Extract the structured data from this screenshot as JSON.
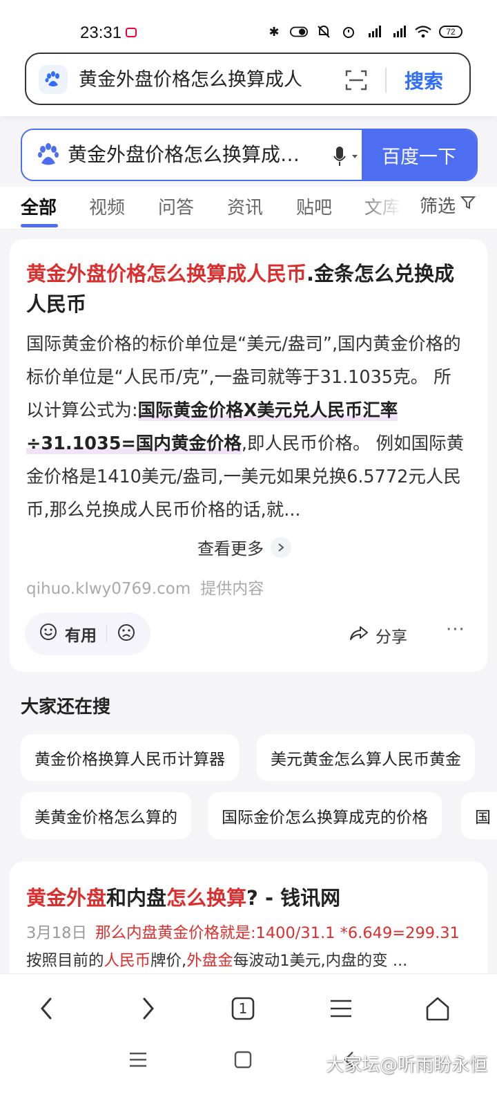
{
  "status": {
    "time": "23:31",
    "battery": "72"
  },
  "address_bar": {
    "query": "黄金外盘价格怎么换算成人",
    "search_label": "搜索"
  },
  "search_box": {
    "query": "黄金外盘价格怎么换算成人民币",
    "button_label": "百度一下"
  },
  "tabs": {
    "items": [
      {
        "label": "全部"
      },
      {
        "label": "视频"
      },
      {
        "label": "问答"
      },
      {
        "label": "资讯"
      },
      {
        "label": "贴吧"
      },
      {
        "label": "文库"
      }
    ],
    "filter_label": "筛选"
  },
  "result1": {
    "title_hl": "黄金外盘价格怎么换算成人民币",
    "title_rest": ".金条怎么兑换成人民币",
    "abstract_pre": "国际黄金价格的标价单位是“美元/盎司”,国内黄金价格的标价单位是“人民币/克”,一盎司就等于31.1035克。 所以计算公式为:",
    "abstract_strong": "国际黄金价格X美元兑人民币汇率÷31.1035=国内黄金价格",
    "abstract_post": ",即人民币价格。 例如国际黄金价格是1410美元/盎司,一美元如果兑换6.5772元人民币,那么兑换成人民币价格的话,就...",
    "more_label": "查看更多",
    "source": "qihuo.klwy0769.com",
    "source_label": "提供内容",
    "useful_label": "有用",
    "share_label": "分享",
    "more_dots": "···"
  },
  "also_search": {
    "title": "大家还在搜",
    "chips": [
      "黄金价格换算人民币计算器",
      "美元黄金怎么算人民币黄金",
      "美黄金价格怎么算的",
      "国际金价怎么换算成克的价格",
      "国"
    ]
  },
  "result2": {
    "title_hl1": "黄金外盘",
    "title_mid": "和内盘",
    "title_hl2": "怎么换算",
    "title_rest": "? - 钱讯网",
    "date": "3月18日",
    "line1_red": "那么内盘黄金价格就是:1400/31.1 *6.649=299.31",
    "line2_pre": "按照目前的",
    "line2_red1": "人民币",
    "line2_mid": "牌价,",
    "line2_red2": "外盘金",
    "line2_post": "每波动1美元,内盘的变 ..."
  },
  "browser_nav": {
    "tab_count": "1"
  },
  "watermark": "大家坛@听雨盼永恒",
  "colors": {
    "accent": "#4e6ef2",
    "highlight_red": "#d9302f",
    "address_search_blue": "#2f6ef5"
  }
}
